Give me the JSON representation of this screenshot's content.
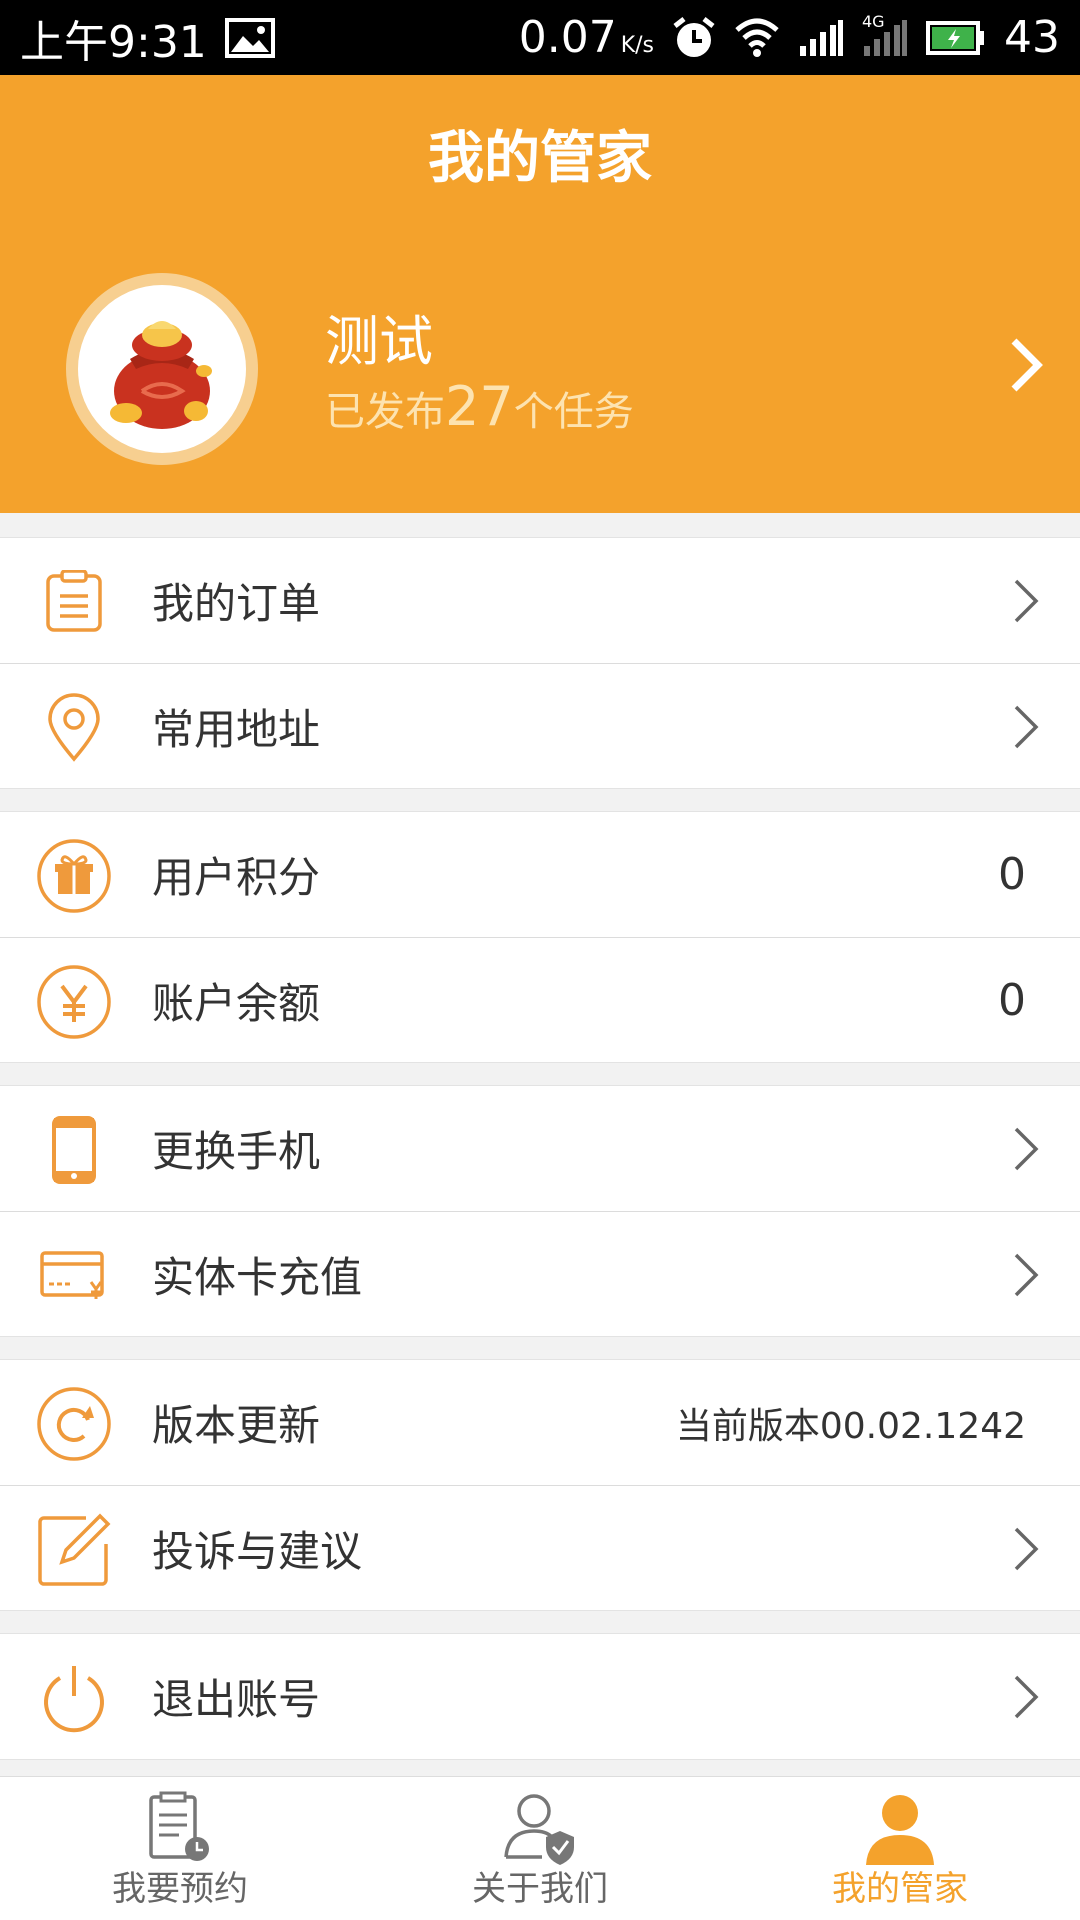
{
  "status_bar": {
    "time": "上午9:31",
    "speed": "0.07",
    "speed_unit": "K/s",
    "network": "4G",
    "battery": "43"
  },
  "header": {
    "title": "我的管家",
    "user_name": "测试",
    "sub_prefix": "已发布",
    "task_count": "27",
    "sub_suffix": "个任务"
  },
  "menu": {
    "orders": "我的订单",
    "address": "常用地址",
    "points": "用户积分",
    "points_value": "0",
    "balance": "账户余额",
    "balance_value": "0",
    "change_phone": "更换手机",
    "card_recharge": "实体卡充值",
    "version_update": "版本更新",
    "version_value": "当前版本00.02.1242",
    "feedback": "投诉与建议",
    "logout": "退出账号"
  },
  "tabs": [
    {
      "label": "我要预约"
    },
    {
      "label": "关于我们"
    },
    {
      "label": "我的管家"
    }
  ],
  "colors": {
    "accent": "#f4a22c",
    "icon": "#ef9a3c",
    "status_bg": "#000000"
  }
}
